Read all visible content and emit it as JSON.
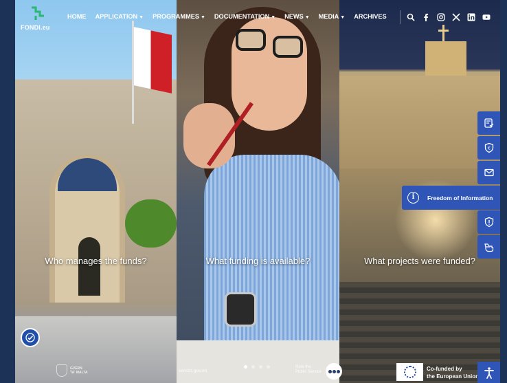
{
  "brand": {
    "logo_text": "FONDI.eu",
    "logo_icon": "fondi-logo-icon",
    "accent": "#2f55b7",
    "logo_color": "#2bb673"
  },
  "nav": {
    "items": [
      {
        "label": "HOME",
        "has_dropdown": false
      },
      {
        "label": "APPLICATION",
        "has_dropdown": true
      },
      {
        "label": "PROGRAMMES",
        "has_dropdown": true
      },
      {
        "label": "DOCUMENTATION",
        "has_dropdown": true
      },
      {
        "label": "NEWS",
        "has_dropdown": true
      },
      {
        "label": "MEDIA",
        "has_dropdown": true
      },
      {
        "label": "ARCHIVES",
        "has_dropdown": false
      }
    ],
    "icons": [
      "search-icon",
      "facebook-icon",
      "instagram-icon",
      "x-icon",
      "linkedin-icon",
      "youtube-icon"
    ]
  },
  "panels": [
    {
      "caption": "Who manages the funds?"
    },
    {
      "caption": "What funding is available?"
    },
    {
      "caption": "What projects were funded?"
    }
  ],
  "side_toolbar": {
    "icons": [
      "form-check-icon",
      "shield-euro-icon",
      "envelope-icon",
      "info-icon",
      "shield-alert-icon",
      "hand-pointer-icon"
    ],
    "expanded_label": "Freedom of Information"
  },
  "footer": {
    "gov_text_1": "GVERN",
    "gov_text_2": "TA' MALTA",
    "servizz": "servizz.gov.mt",
    "rate_line_1": "Rate the",
    "rate_line_2": "Public Service",
    "eu_line_1": "Co-funded by",
    "eu_line_2": "the European Union",
    "carousel_dots": 4,
    "active_dot": 0
  }
}
